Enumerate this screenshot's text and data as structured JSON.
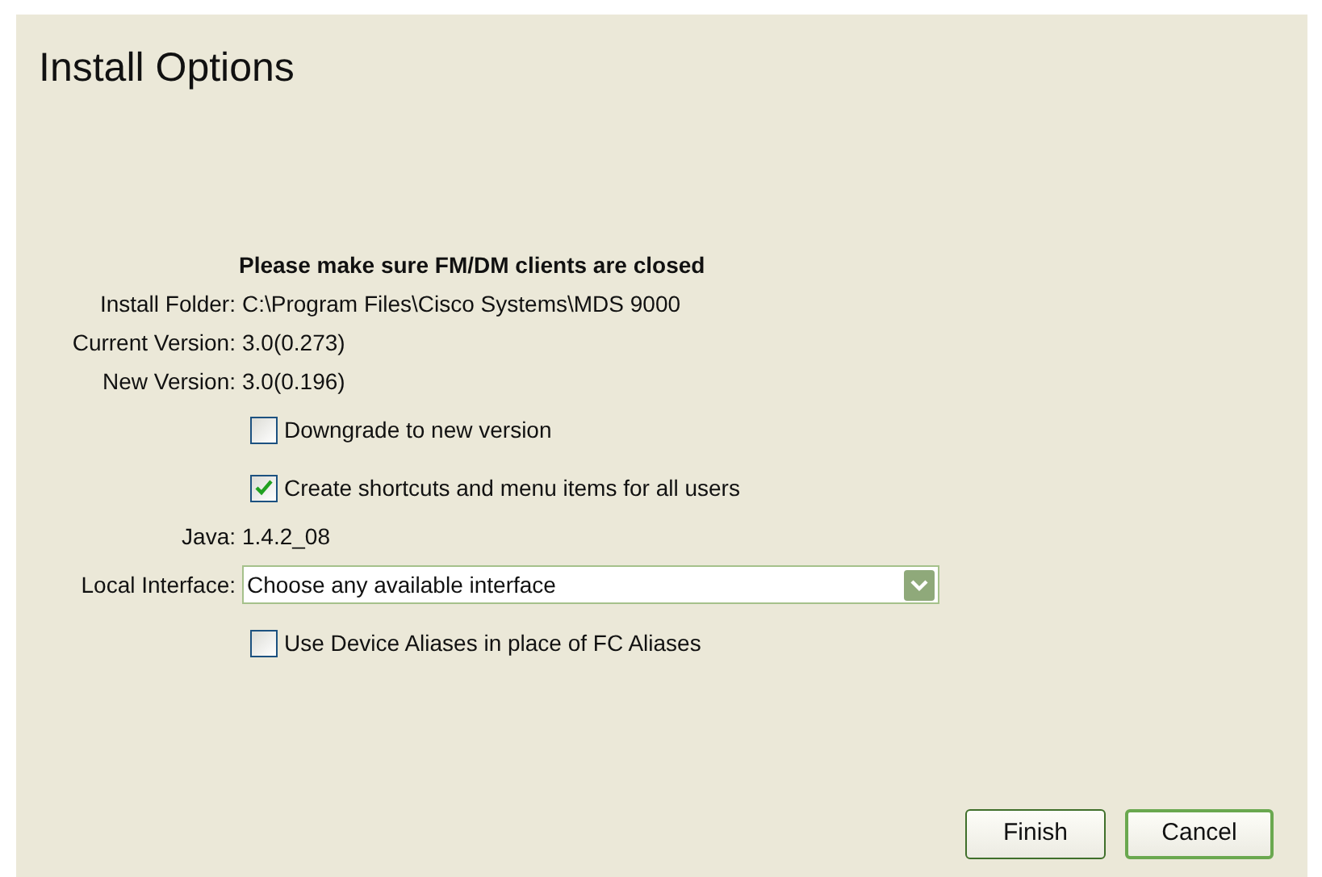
{
  "title": "Install Options",
  "notice": "Please make sure FM/DM clients are closed",
  "rows": [
    {
      "kind": "info",
      "label": "Install Folder:",
      "value": "C:\\Program Files\\Cisco Systems\\MDS 9000"
    },
    {
      "kind": "info",
      "label": "Current Version:",
      "value": "3.0(0.273)"
    },
    {
      "kind": "info",
      "label": "New Version:",
      "value": "3.0(0.196)"
    },
    {
      "kind": "checkbox",
      "text": "Downgrade to new version",
      "checked": false
    },
    {
      "kind": "checkbox",
      "text": "Create shortcuts and menu items for all users",
      "checked": true
    },
    {
      "kind": "info",
      "label": "Java:",
      "value": "1.4.2_08"
    },
    {
      "kind": "select",
      "label": "Local Interface:",
      "value": "Choose any available interface"
    },
    {
      "kind": "checkbox",
      "text": "Use Device Aliases in place of FC Aliases",
      "checked": false
    }
  ],
  "buttons": [
    {
      "label": "Finish",
      "selected": false
    },
    {
      "label": "Cancel",
      "selected": true
    }
  ]
}
